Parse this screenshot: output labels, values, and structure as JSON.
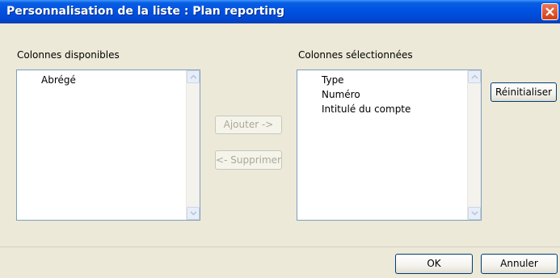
{
  "window": {
    "title": "Personnalisation de la liste : Plan reporting",
    "close_icon": "close-icon"
  },
  "available": {
    "label": "Colonnes disponibles",
    "items": [
      "Abrégé"
    ]
  },
  "selected": {
    "label": "Colonnes sélectionnées",
    "items": [
      "Type",
      "Numéro",
      "Intitulé du compte"
    ]
  },
  "buttons": {
    "add": "Ajouter ->",
    "remove": "<- Supprimer",
    "reset": "Réinitialiser",
    "ok": "OK",
    "cancel": "Annuler"
  }
}
